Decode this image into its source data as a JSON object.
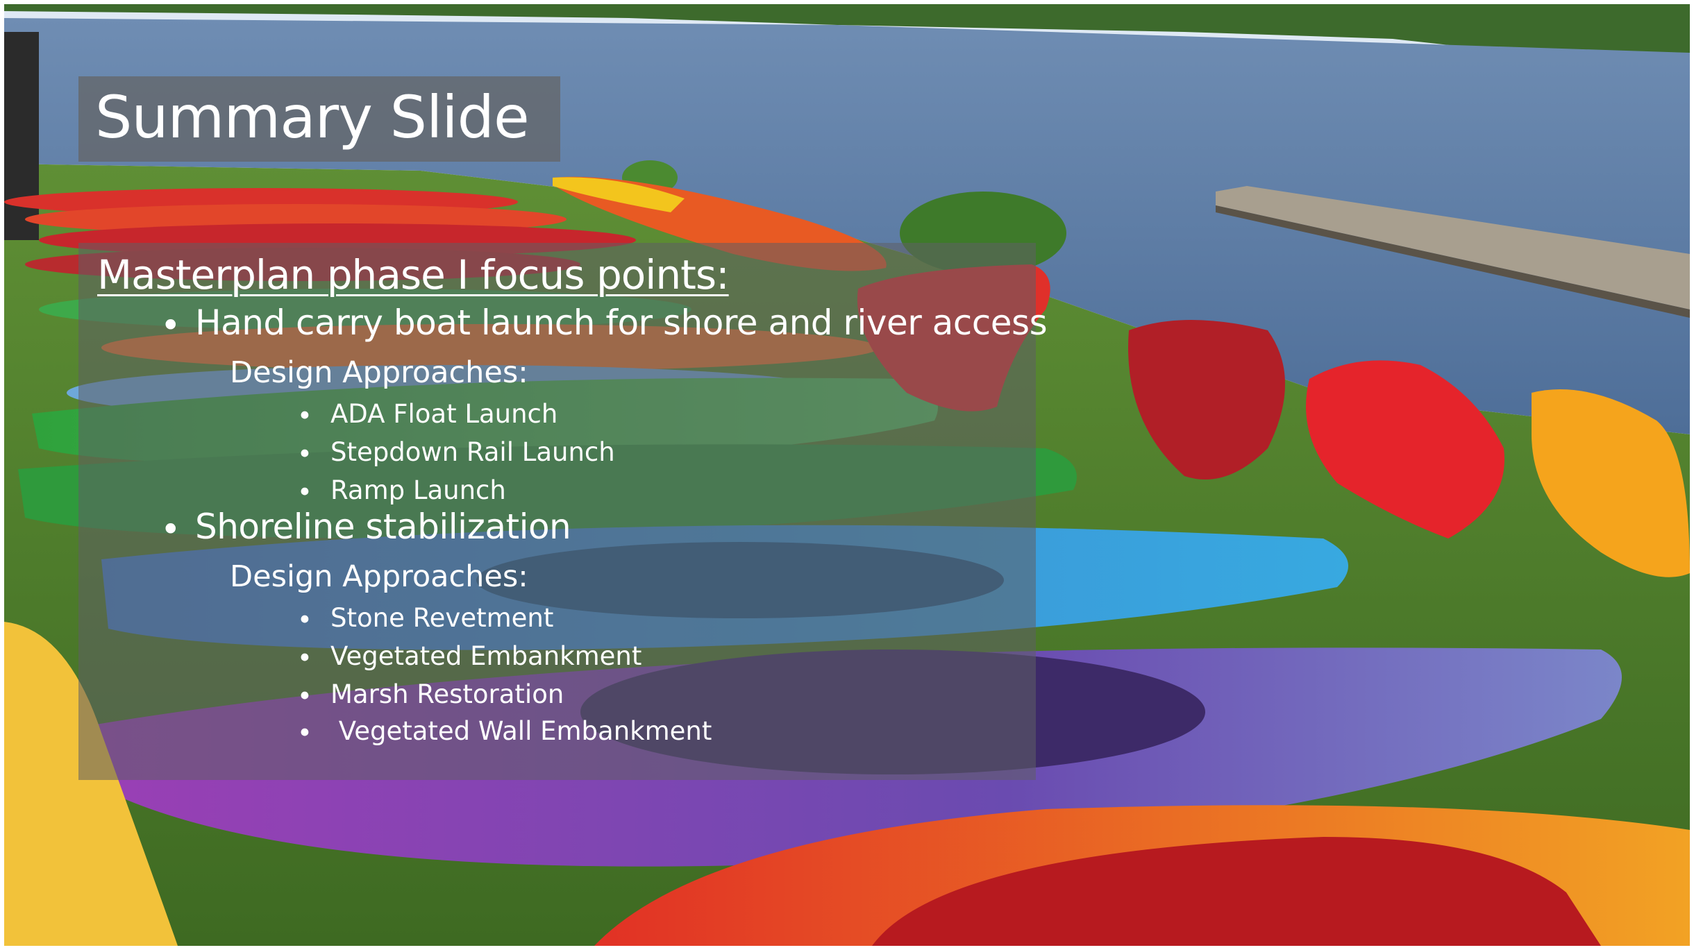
{
  "slide": {
    "title": "Summary Slide",
    "heading": "Masterplan phase I focus points:",
    "bullet_char": "•",
    "items": [
      {
        "label": "Hand carry boat launch for shore and river access",
        "subheading": "Design Approaches:",
        "approaches": [
          "ADA Float Launch",
          "Stepdown Rail Launch",
          "Ramp Launch"
        ]
      },
      {
        "label": "Shoreline stabilization",
        "subheading": "Design Approaches:",
        "approaches": [
          "Stone Revetment",
          "Vegetated Embankment",
          "Marsh Restoration",
          " Vegetated Wall Embankment"
        ]
      }
    ]
  },
  "photo": {
    "description_icon": "kayak-photo",
    "colors": {
      "sky": "#dfe9f4",
      "water": "#5f7fa6",
      "grass": "#4f7d2a",
      "kayak_red": "#d8202a",
      "kayak_orange": "#f28c1c",
      "kayak_yellow": "#f5b71d",
      "kayak_green": "#3bb04a",
      "kayak_blue": "#3e8fd6",
      "kayak_purple": "#6a3ea0"
    }
  }
}
